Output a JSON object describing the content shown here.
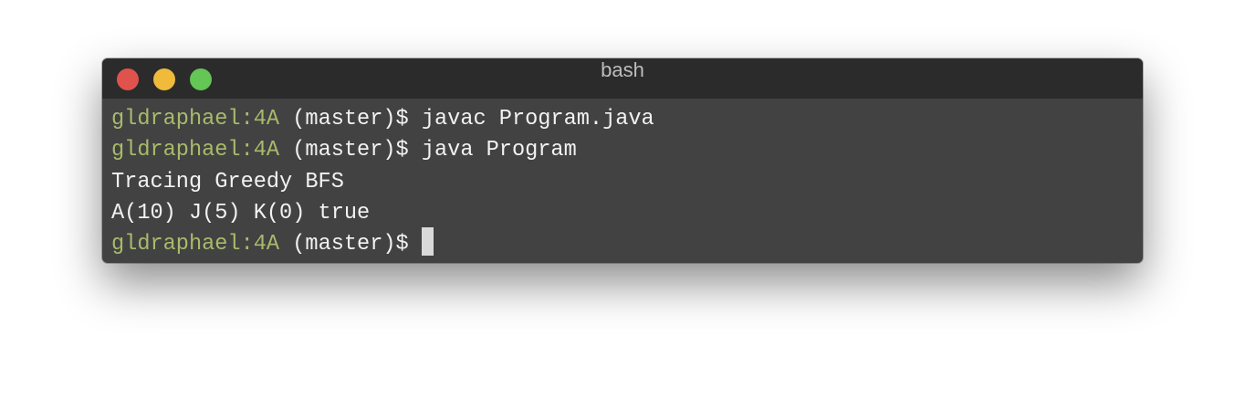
{
  "window": {
    "title": "bash",
    "buttons": {
      "close_color": "#e0524c",
      "minimize_color": "#f0bb3b",
      "maximize_color": "#63c655"
    }
  },
  "terminal": {
    "lines": [
      {
        "user": "gldraphael",
        "sep": ":",
        "dir": "4A",
        "branch": " (master)$ ",
        "cmd": "javac Program.java"
      },
      {
        "user": "gldraphael",
        "sep": ":",
        "dir": "4A",
        "branch": " (master)$ ",
        "cmd": "java Program"
      },
      {
        "output": "Tracing Greedy BFS"
      },
      {
        "output": "A(10) J(5) K(0) true"
      },
      {
        "user": "gldraphael",
        "sep": ":",
        "dir": "4A",
        "branch": " (master)$ ",
        "cmd": ""
      }
    ]
  }
}
